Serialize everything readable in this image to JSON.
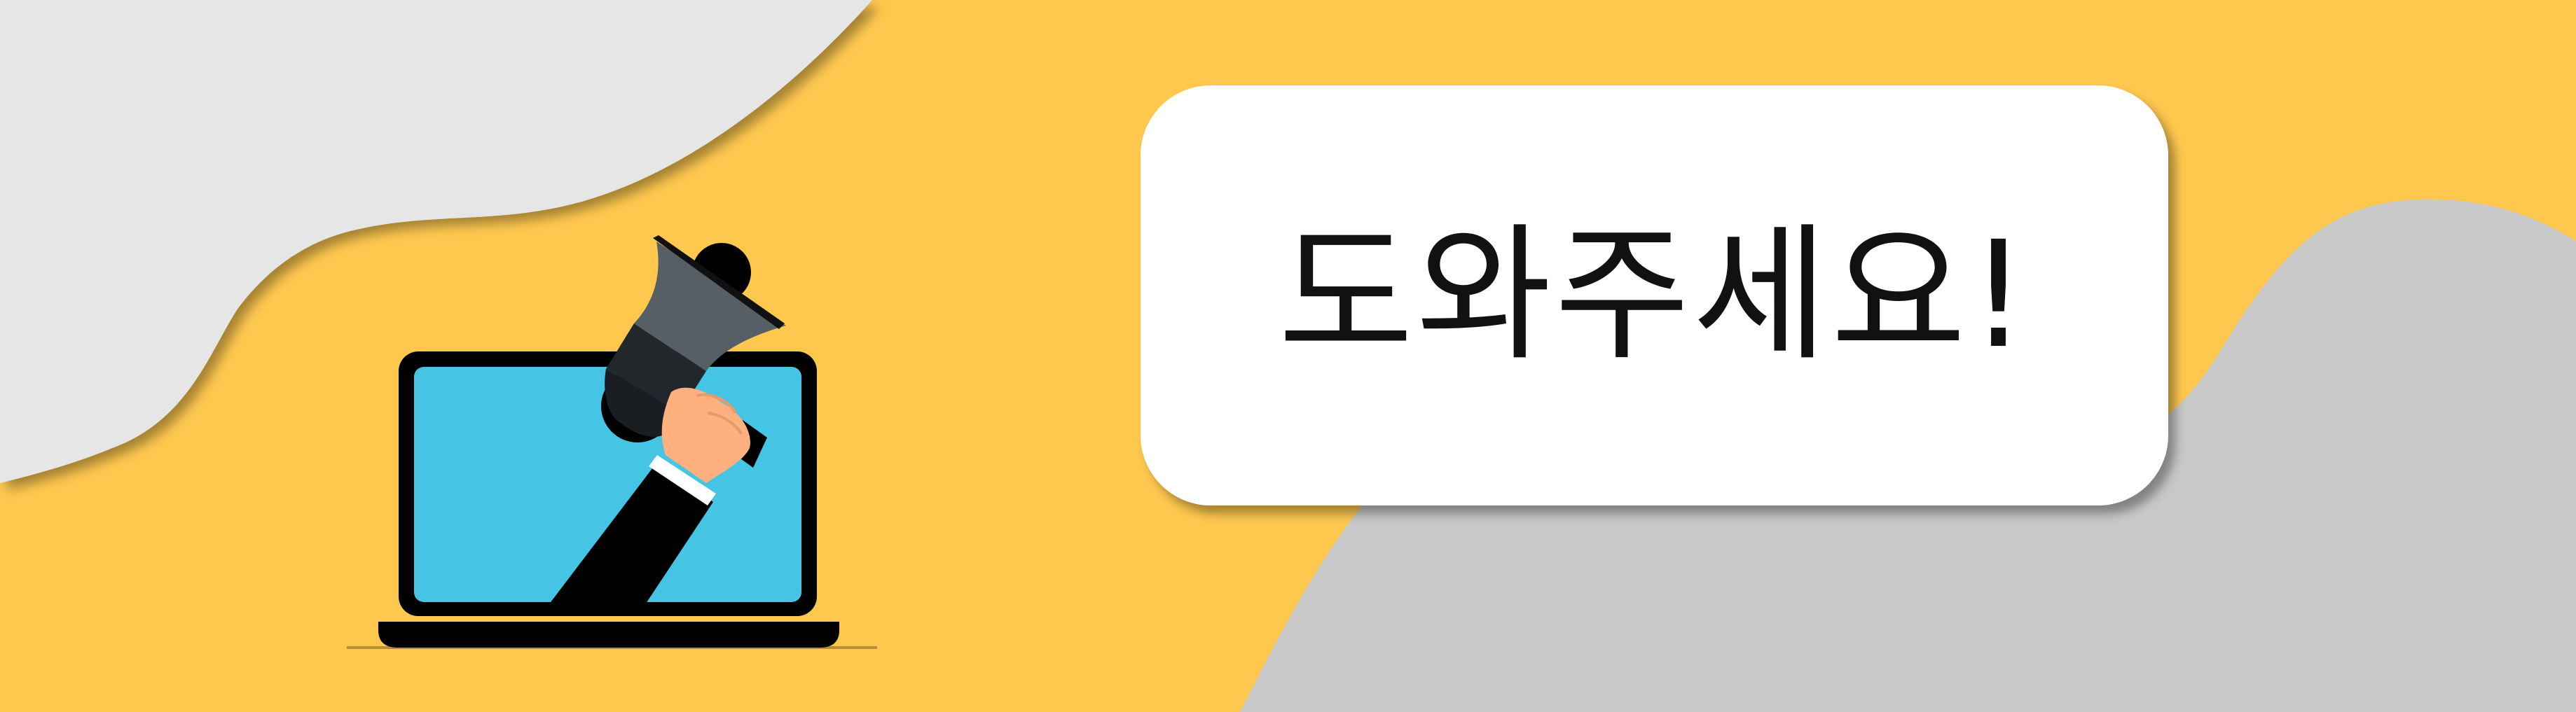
{
  "banner": {
    "headline": "도와주세요!",
    "colors": {
      "background": "#FEC84F",
      "blob_light": "#E6E6E6",
      "blob_gray": "#C8C8C8",
      "card": "#FFFFFF",
      "screen": "#45C4E4",
      "megaphone": "#565E66",
      "sleeve": "#000000",
      "hand": "#FFB07E"
    },
    "icons": {
      "laptop": "laptop-icon",
      "megaphone": "megaphone-icon",
      "hand": "hand-icon"
    }
  }
}
